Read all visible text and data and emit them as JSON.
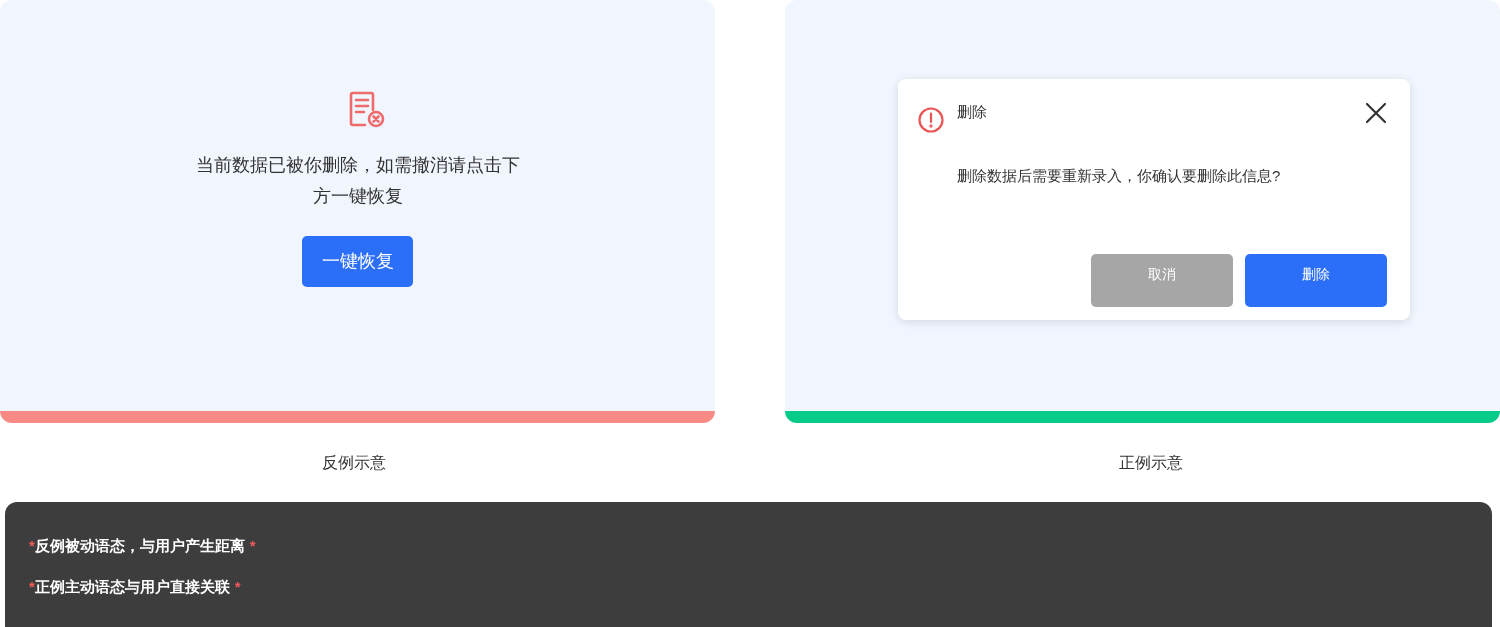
{
  "panels": [
    {
      "kind": "bad",
      "color": "#f88a86",
      "message": "当前数据已被你删除，如需撤消请点击下方一键恢复",
      "button": "一键恢复",
      "caption": "反例示意"
    },
    {
      "kind": "good",
      "color": "#07cc89",
      "dialog": {
        "title": "删除",
        "message": "删除数据后需要重新录入，你确认要删除此信息?",
        "buttons": [
          {
            "label": "取消",
            "kind": "secondary"
          },
          {
            "label": "删除",
            "kind": "primary"
          }
        ]
      },
      "caption": "正例示意"
    }
  ],
  "notes": [
    {
      "lead": "*",
      "text": "反例被动语态，与用户产生距离",
      "trail": "*"
    },
    {
      "lead": "*",
      "text": "正例主动语态与用户直接关联",
      "trail": "*"
    }
  ]
}
